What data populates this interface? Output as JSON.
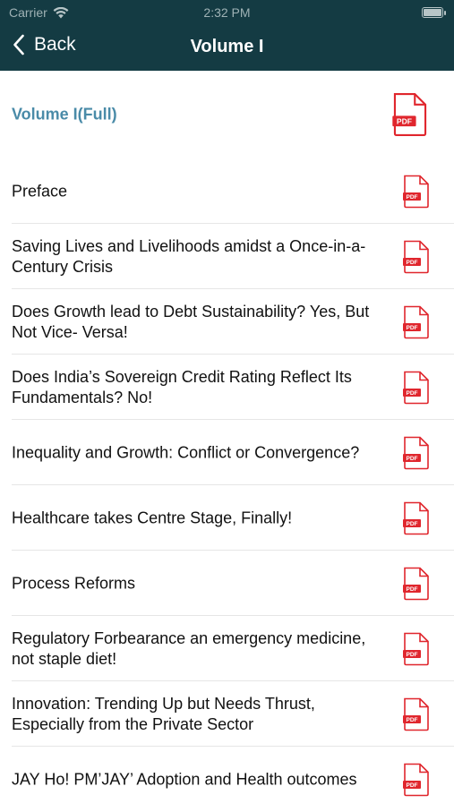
{
  "status_bar": {
    "carrier": "Carrier",
    "time": "2:32 PM"
  },
  "nav": {
    "back_label": "Back",
    "title": "Volume I"
  },
  "colors": {
    "nav_background": "#143b43",
    "full_title": "#4a8ba8",
    "pdf_red": "#e0262d"
  },
  "items": [
    {
      "title": "Volume I(Full)",
      "icon": "pdf-icon"
    },
    {
      "title": "Preface",
      "icon": "pdf-icon"
    },
    {
      "title": "Saving Lives and Livelihoods amidst a Once-in-a-Century Crisis",
      "icon": "pdf-icon"
    },
    {
      "title": "Does Growth lead to Debt Sustainability? Yes, But Not Vice- Versa!",
      "icon": "pdf-icon"
    },
    {
      "title": "Does India’s Sovereign Credit Rating Reflect Its Fundamentals? No!",
      "icon": "pdf-icon"
    },
    {
      "title": "Inequality and Growth: Conflict or Convergence?",
      "icon": "pdf-icon"
    },
    {
      "title": "Healthcare takes Centre Stage, Finally!",
      "icon": "pdf-icon"
    },
    {
      "title": "Process Reforms",
      "icon": "pdf-icon"
    },
    {
      "title": "Regulatory Forbearance an emergency medicine, not staple diet!",
      "icon": "pdf-icon"
    },
    {
      "title": "Innovation: Trending Up but Needs Thrust, Especially from the Private Sector",
      "icon": "pdf-icon"
    },
    {
      "title": "JAY Ho! PM’JAY’ Adoption and Health outcomes",
      "icon": "pdf-icon"
    }
  ],
  "pdf_icon_text": "PDF"
}
